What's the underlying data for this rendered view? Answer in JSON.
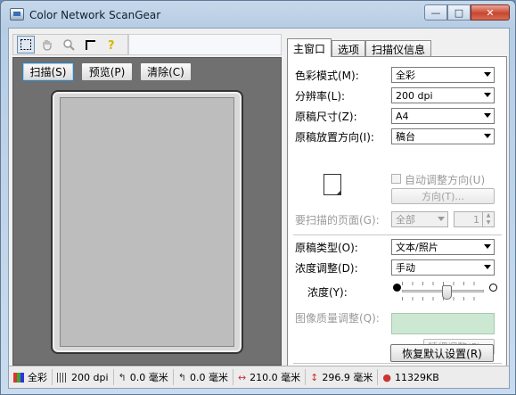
{
  "window": {
    "title": "Color Network ScanGear",
    "minimize": "—",
    "maximize": "□",
    "close": "✕"
  },
  "toolbar": {
    "icons": [
      "select-rect",
      "hand",
      "zoom",
      "crop",
      "help"
    ]
  },
  "preview": {
    "buttons": {
      "scan": "扫描(S)",
      "preview": "预览(P)",
      "clear": "清除(C)"
    }
  },
  "tabs": [
    {
      "label": "主窗口",
      "active": true
    },
    {
      "label": "选项",
      "active": false
    },
    {
      "label": "扫描仪信息",
      "active": false
    }
  ],
  "main": {
    "color_mode": {
      "label": "色彩模式(M):",
      "value": "全彩"
    },
    "resolution": {
      "label": "分辨率(L):",
      "value": "200 dpi"
    },
    "original_size": {
      "label": "原稿尺寸(Z):",
      "value": "A4"
    },
    "orientation": {
      "label": "原稿放置方向(I):",
      "value": "稿台"
    },
    "auto_orientation": {
      "label": "自动调整方向(U)",
      "checked": false
    },
    "direction_button": "方向(T)...",
    "pages": {
      "label": "要扫描的页面(G):",
      "value": "全部",
      "spin_value": "1"
    },
    "original_type": {
      "label": "原稿类型(O):",
      "value": "文本/照片"
    },
    "density_adjust": {
      "label": "浓度调整(D):",
      "value": "手动"
    },
    "density": {
      "label": "浓度(Y):",
      "level": 0.55
    },
    "image_quality": {
      "label": "图像质量调整(Q):"
    },
    "fine_adjust_button": "精细调整(F)...",
    "restore_defaults_button": "恢复默认设置(R)"
  },
  "status_bar": {
    "color": "全彩",
    "resolution": "200 dpi",
    "x_offset": "0.0 毫米",
    "y_offset": "0.0 毫米",
    "width": "210.0 毫米",
    "height": "296.9 毫米",
    "size": "11329KB"
  },
  "colors": {
    "title_gradient": "#c6d8eb",
    "preview_bg": "#707070",
    "quality_box": "#cce8d2",
    "close_button": "#c9462f"
  }
}
